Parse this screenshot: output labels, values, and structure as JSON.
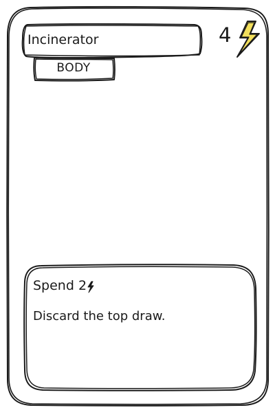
{
  "card": {
    "name": "Incinerator",
    "type": "BODY",
    "cost": "4",
    "cost_icon": "lightning-bolt-icon",
    "ability": {
      "cost_label": "Spend 2",
      "cost_icon": "lightning-bolt-icon",
      "text": "Discard the top draw."
    }
  },
  "colors": {
    "ink": "#1a1a1a",
    "bolt_fill": "#f2df5c",
    "background": "#ffffff"
  }
}
